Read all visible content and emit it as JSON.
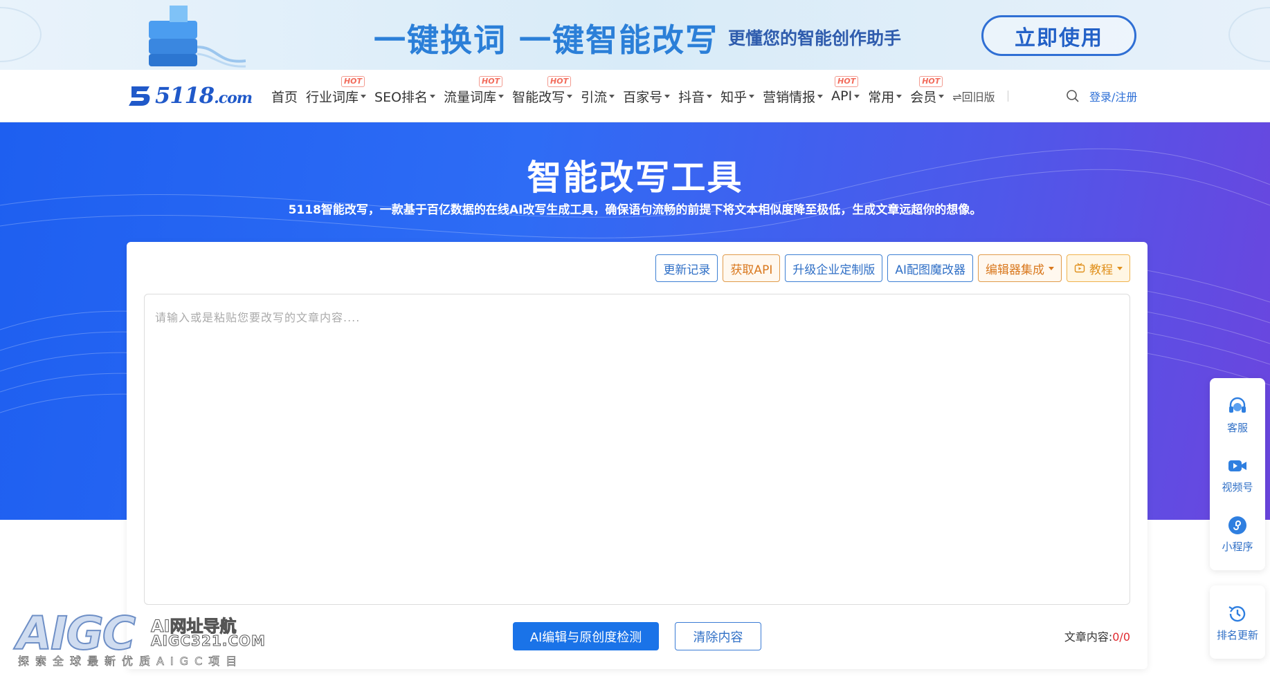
{
  "banner": {
    "headline": "一键换词 一键智能改写",
    "tagline": "更懂您的智能创作助手",
    "cta_label": "立即使用"
  },
  "nav": {
    "logo_main": "5118",
    "logo_suffix": ".com",
    "items": [
      {
        "label": "首页",
        "dropdown": false,
        "hot": false
      },
      {
        "label": "行业词库",
        "dropdown": true,
        "hot": true
      },
      {
        "label": "SEO排名",
        "dropdown": true,
        "hot": false
      },
      {
        "label": "流量词库",
        "dropdown": true,
        "hot": true
      },
      {
        "label": "智能改写",
        "dropdown": true,
        "hot": true
      },
      {
        "label": "引流",
        "dropdown": true,
        "hot": false
      },
      {
        "label": "百家号",
        "dropdown": true,
        "hot": false
      },
      {
        "label": "抖音",
        "dropdown": true,
        "hot": false
      },
      {
        "label": "知乎",
        "dropdown": true,
        "hot": false
      },
      {
        "label": "营销情报",
        "dropdown": true,
        "hot": false
      },
      {
        "label": "API",
        "dropdown": true,
        "hot": true
      },
      {
        "label": "常用",
        "dropdown": true,
        "hot": false
      },
      {
        "label": "会员",
        "dropdown": true,
        "hot": true
      }
    ],
    "hot_label": "HOT",
    "old_version": "⇌回旧版",
    "login_label": "登录/注册"
  },
  "hero": {
    "title": "智能改写工具",
    "subtitle": "5118智能改写，一款基于百亿数据的在线AI改写生成工具，确保语句流畅的前提下将文本相似度降至极低，生成文章远超你的想像。"
  },
  "toolbar": {
    "changelog": "更新记录",
    "get_api": "获取API",
    "enterprise": "升级企业定制版",
    "ai_image": "AI配图魔改器",
    "editor_integration": "编辑器集成",
    "tutorial": "教程"
  },
  "editor": {
    "placeholder": "请输入或是粘贴您要改写的文章内容....",
    "value": ""
  },
  "actions": {
    "primary": "AI编辑与原创度检测",
    "clear": "清除内容"
  },
  "counter": {
    "label": "文章内容:",
    "value": "0/0"
  },
  "side": {
    "service": "客服",
    "video": "视频号",
    "mini_program": "小程序",
    "rank_update": "排名更新"
  },
  "watermark": {
    "brand": "AIGC",
    "line1": "AI网址导航",
    "line2": "AIGC321.COM",
    "line3": "探索全球最新优质AIGC项目"
  },
  "colors": {
    "brand_blue": "#1a73e8",
    "hot_red": "#f26b5b",
    "count_red": "#e0292f"
  }
}
